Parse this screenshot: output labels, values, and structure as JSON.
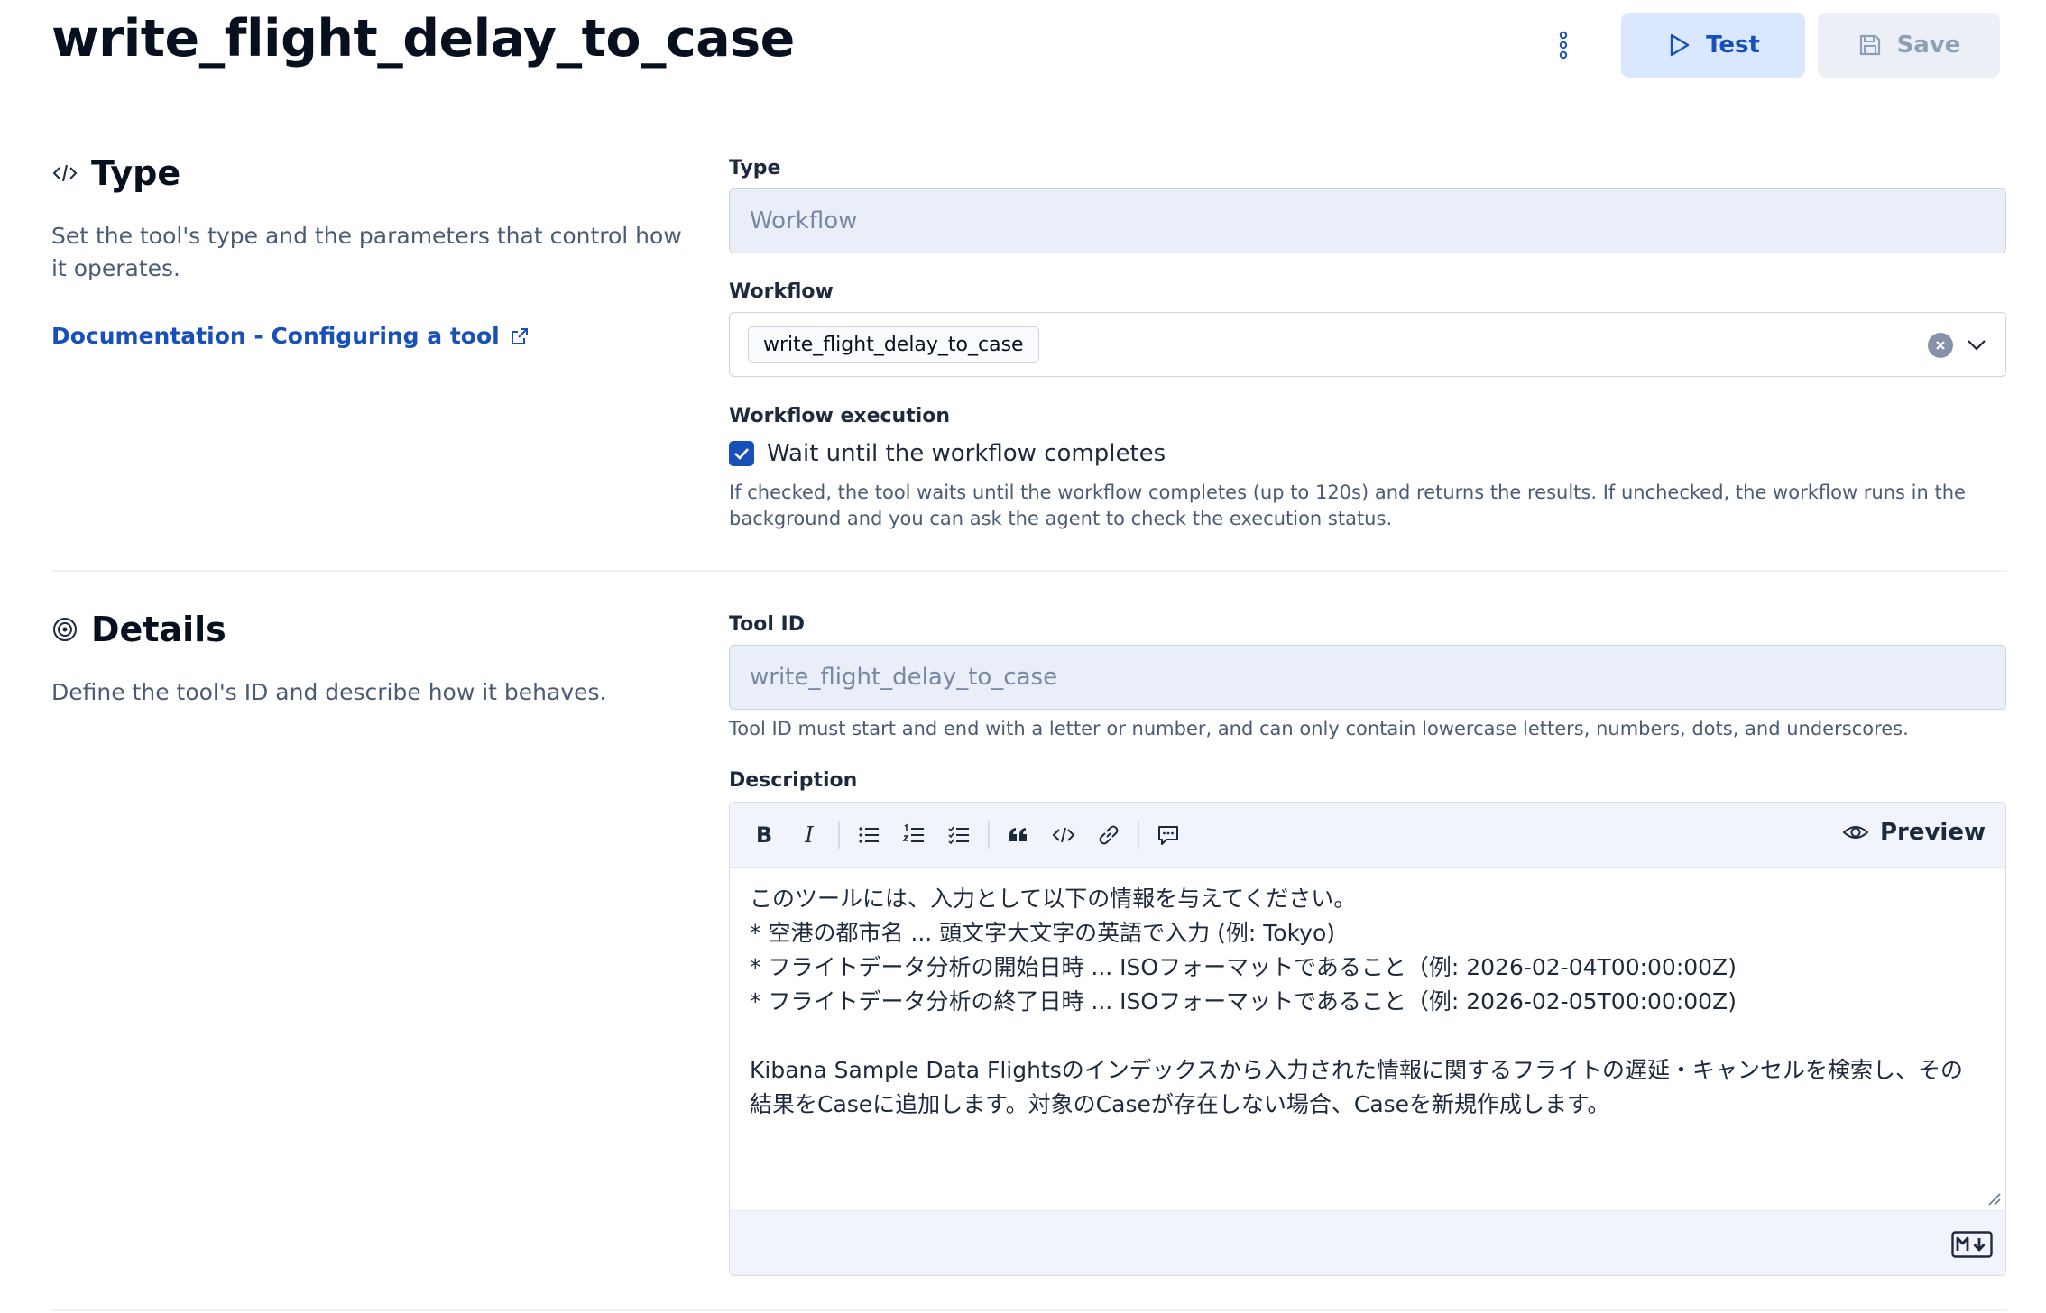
{
  "header": {
    "title": "write_flight_delay_to_case",
    "test_label": "Test",
    "save_label": "Save"
  },
  "type_section": {
    "heading": "Type",
    "description": "Set the tool's type and the parameters that control how it operates.",
    "doc_link": "Documentation - Configuring a tool",
    "type_field": {
      "label": "Type",
      "value": "Workflow"
    },
    "workflow_field": {
      "label": "Workflow",
      "selected": "write_flight_delay_to_case"
    },
    "execution": {
      "label": "Workflow execution",
      "checkbox_label": "Wait until the workflow completes",
      "checked": true,
      "help": "If checked, the tool waits until the workflow completes (up to 120s) and returns the results. If unchecked, the workflow runs in the background and you can ask the agent to check the execution status."
    }
  },
  "details_section": {
    "heading": "Details",
    "description": "Define the tool's ID and describe how it behaves.",
    "tool_id": {
      "label": "Tool ID",
      "value": "write_flight_delay_to_case",
      "help": "Tool ID must start and end with a letter or number, and can only contain lowercase letters, numbers, dots, and underscores."
    },
    "description_field": {
      "label": "Description",
      "preview_label": "Preview",
      "text": "このツールには、入力として以下の情報を与えてください。\n* 空港の都市名 ... 頭文字大文字の英語で入力 (例: Tokyo)\n* フライトデータ分析の開始日時 ... ISOフォーマットであること（例: 2026-02-04T00:00:00Z)\n* フライトデータ分析の終了日時 ... ISOフォーマットであること（例: 2026-02-05T00:00:00Z)\n\nKibana Sample Data Flightsのインデックスから入力された情報に関するフライトの遅延・キャンセルを検索し、その結果をCaseに追加します。対象のCaseが存在しない場合、Caseを新規作成します。"
    }
  },
  "colors": {
    "accent": "#1750ba",
    "accent_light": "#d9e8ff",
    "readonly_bg": "#e9eef9",
    "disabled_text": "#8e9fb8"
  }
}
